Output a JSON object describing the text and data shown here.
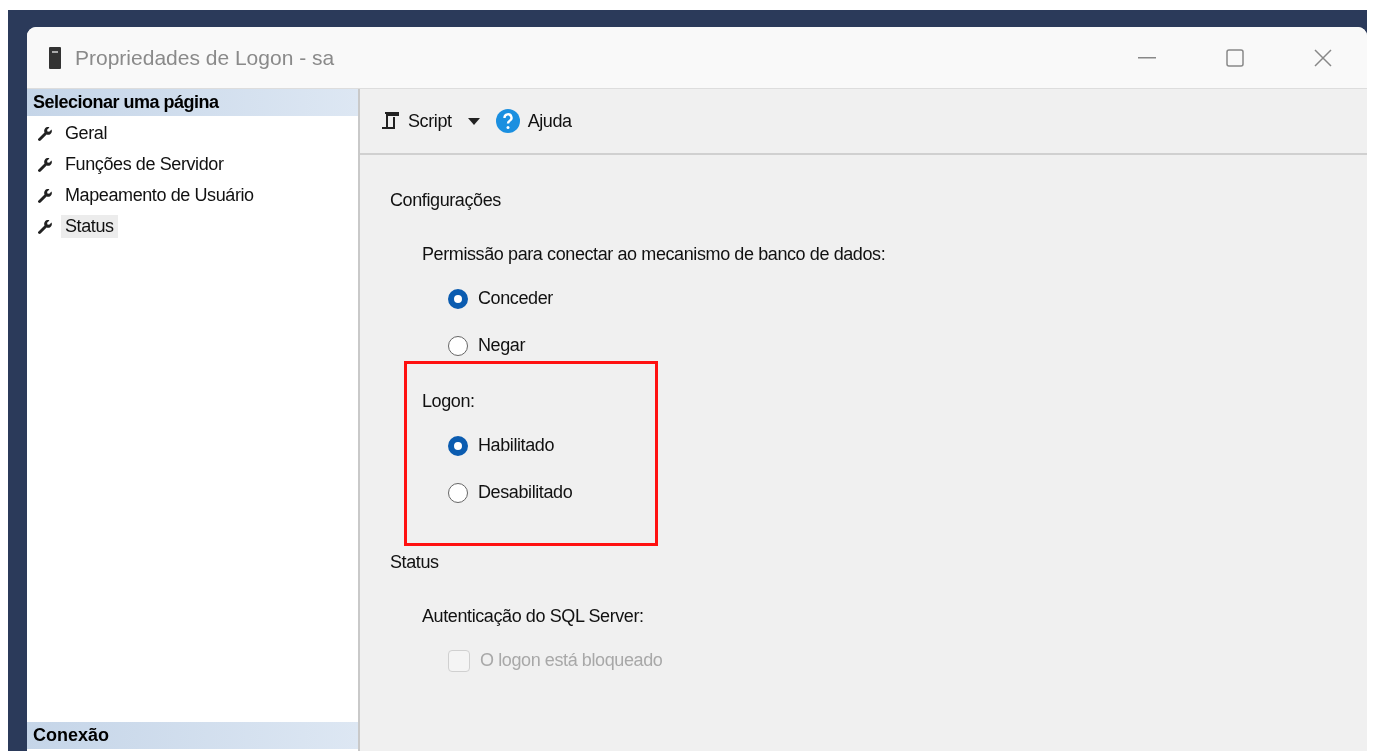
{
  "window": {
    "title": "Propriedades de Logon - sa"
  },
  "sidebar": {
    "header": "Selecionar uma página",
    "items": [
      {
        "label": "Geral",
        "selected": false
      },
      {
        "label": "Funções de Servidor",
        "selected": false
      },
      {
        "label": "Mapeamento de Usuário",
        "selected": false
      },
      {
        "label": "Status",
        "selected": true
      }
    ],
    "footer_header": "Conexão"
  },
  "toolbar": {
    "buttons": [
      {
        "kind": "script",
        "label": "Script"
      },
      {
        "kind": "help",
        "label": "Ajuda"
      }
    ]
  },
  "content": {
    "sections": [
      {
        "title": "Configurações",
        "groups": [
          {
            "kind": "radio",
            "label": "Permissão para conectar ao mecanismo de banco de dados:",
            "options": [
              {
                "label": "Conceder",
                "selected": true
              },
              {
                "label": "Negar",
                "selected": false
              }
            ]
          },
          {
            "kind": "radio",
            "label": "Logon:",
            "options": [
              {
                "label": "Habilitado",
                "selected": true
              },
              {
                "label": "Desabilitado",
                "selected": false
              }
            ]
          }
        ]
      },
      {
        "title": "Status",
        "groups": [
          {
            "kind": "checkbox",
            "label": "Autenticação do SQL Server:",
            "options": [
              {
                "label": "O logon está bloqueado",
                "checked": false,
                "disabled": true
              }
            ]
          }
        ]
      }
    ]
  }
}
